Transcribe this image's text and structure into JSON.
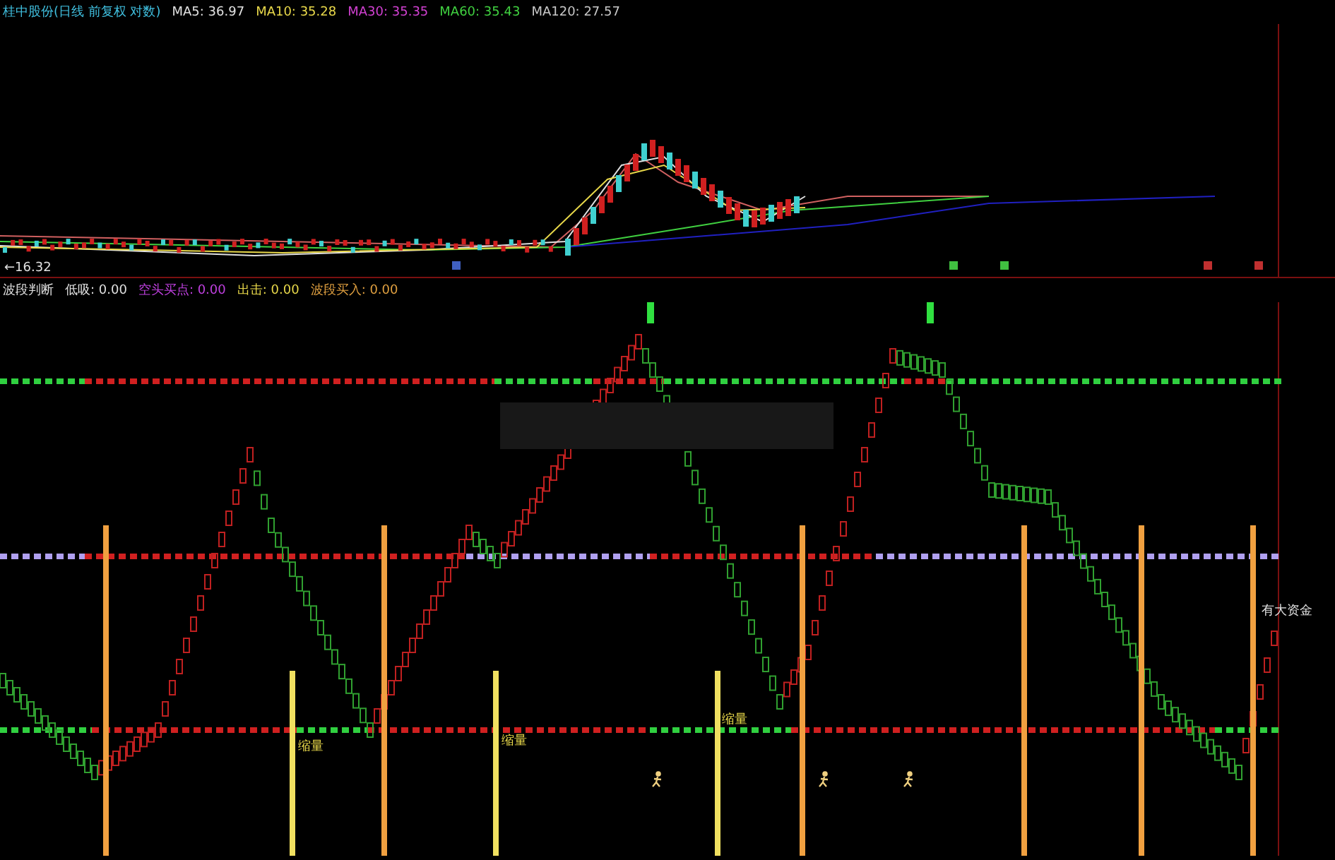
{
  "price_pane": {
    "title": "桂中股份(日线 前复权 对数)",
    "legend": [
      {
        "text": "MA5: 36.97",
        "color": "#e0e0e0"
      },
      {
        "text": "MA10: 35.28",
        "color": "#e8d84a"
      },
      {
        "text": "MA30: 35.35",
        "color": "#d040d0"
      },
      {
        "text": "MA60: 35.43",
        "color": "#40d040"
      },
      {
        "text": "MA120: 27.57",
        "color": "#c8c8c8"
      }
    ],
    "low_label": "←16.32"
  },
  "indicator_pane": {
    "title": "波段判断",
    "legend": [
      {
        "text": "低吸: 0.00",
        "color": "#e0e0e0"
      },
      {
        "text": "空头买点: 0.00",
        "color": "#c040e0"
      },
      {
        "text": "出击: 0.00",
        "color": "#e8d84a"
      },
      {
        "text": "波段买入: 0.00",
        "color": "#e0a040"
      }
    ],
    "labels": [
      {
        "text": "缩量",
        "kind": "volume"
      },
      {
        "text": "缩量",
        "kind": "volume"
      },
      {
        "text": "缩量",
        "kind": "volume"
      },
      {
        "text": "有大资金",
        "kind": "capital"
      }
    ]
  }
}
